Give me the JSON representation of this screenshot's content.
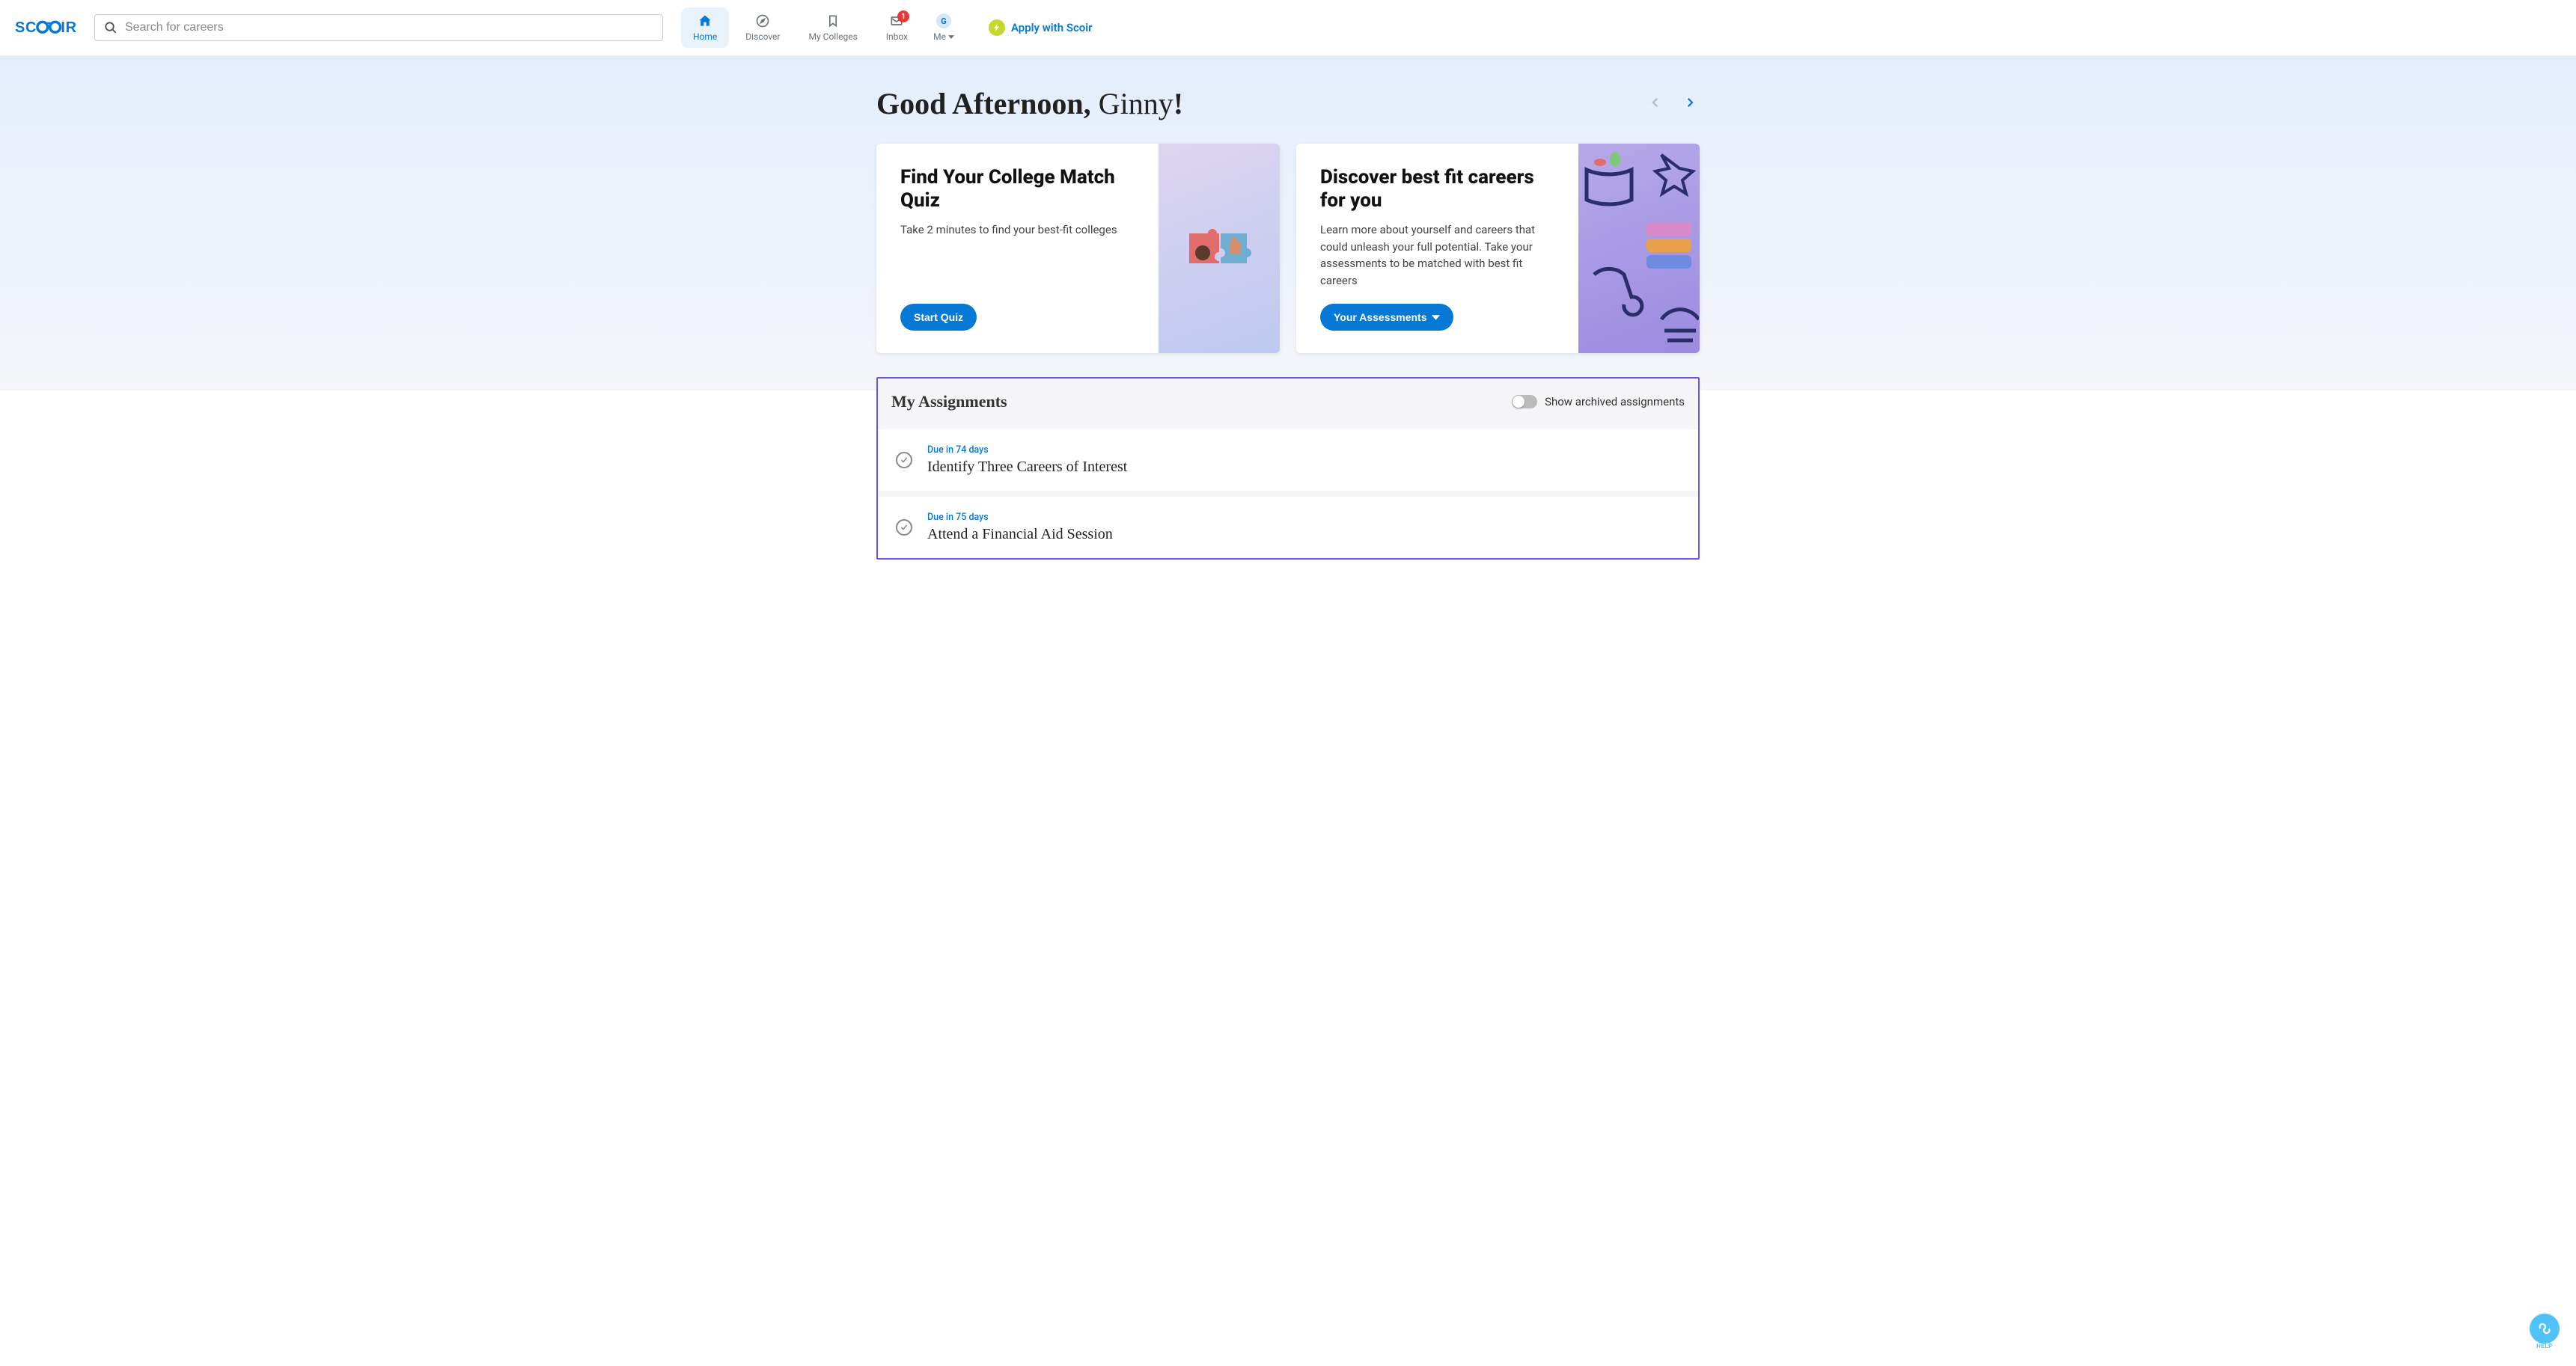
{
  "header": {
    "logo_text": "SCOIR",
    "search_placeholder": "Search for careers",
    "nav": [
      {
        "label": "Home",
        "icon": "home",
        "active": true
      },
      {
        "label": "Discover",
        "icon": "compass",
        "active": false
      },
      {
        "label": "My Colleges",
        "icon": "bookmark",
        "active": false
      },
      {
        "label": "Inbox",
        "icon": "mail",
        "active": false,
        "badge": "1"
      }
    ],
    "me": {
      "initial": "G",
      "label": "Me"
    },
    "apply_label": "Apply with Scoir"
  },
  "greeting": {
    "prefix": "Good Afternoon, ",
    "name": "Ginny",
    "suffix": "!"
  },
  "cards": [
    {
      "title": "Find Your College Match Quiz",
      "description": "Take 2 minutes to find your best-fit colleges",
      "button": "Start Quiz",
      "has_dropdown": false
    },
    {
      "title": "Discover best fit careers for you",
      "description": "Learn more about yourself and careers that could unleash your full potential. Take your assessments to be matched with best fit careers",
      "button": "Your Assessments",
      "has_dropdown": true
    }
  ],
  "assignments": {
    "title": "My Assignments",
    "toggle_label": "Show archived assignments",
    "items": [
      {
        "due": "Due in 74 days",
        "name": "Identify Three Careers of Interest"
      },
      {
        "due": "Due in 75 days",
        "name": "Attend a Financial Aid Session"
      }
    ]
  },
  "help_label": "HELP"
}
